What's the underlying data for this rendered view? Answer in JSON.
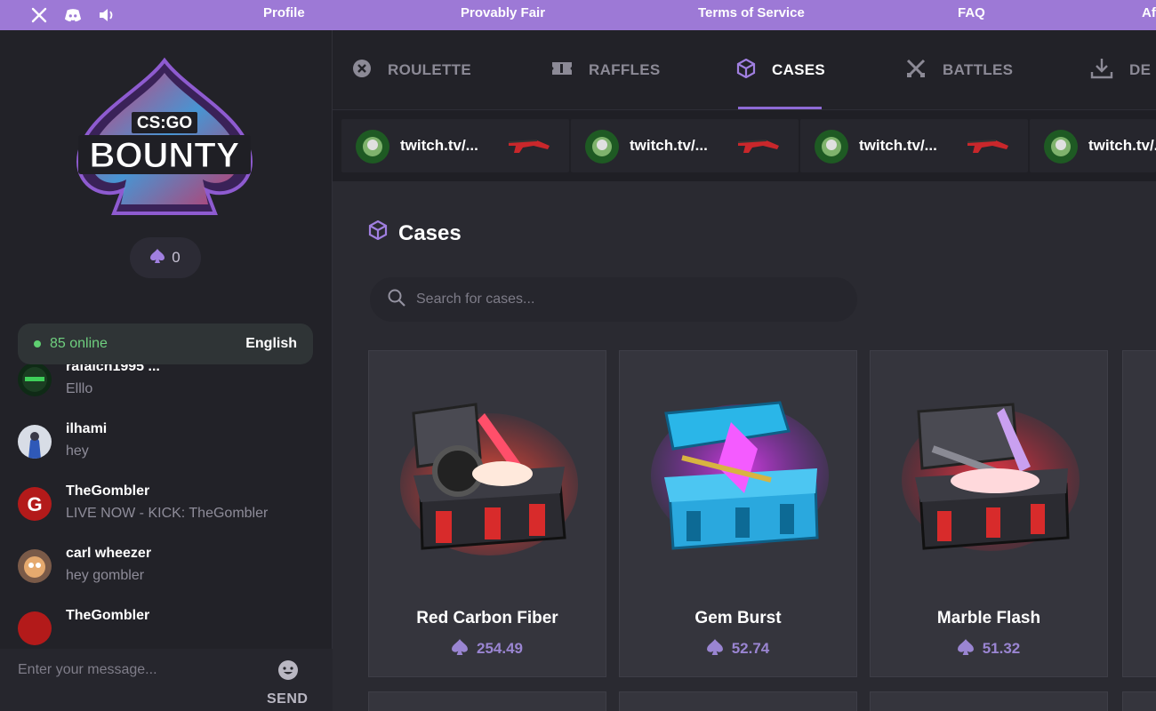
{
  "topbar": {
    "socials": [
      "x-icon",
      "discord-icon",
      "volume-icon"
    ],
    "links": [
      "Profile",
      "Provably Fair",
      "Terms of Service",
      "FAQ",
      "Af"
    ]
  },
  "sidebar": {
    "logo": {
      "line1": "CS:GO",
      "line2": "BOUNTY"
    },
    "balance": "0",
    "online": "85 online",
    "language": "English",
    "messages": [
      {
        "name": "rafalch1995 ...",
        "text": "Elllo"
      },
      {
        "name": "ilhami",
        "text": "hey"
      },
      {
        "name": "TheGombler",
        "text": "LIVE NOW - KICK: TheGombler"
      },
      {
        "name": "carl wheezer",
        "text": "hey gombler"
      },
      {
        "name": "TheGombler",
        "text": ""
      }
    ],
    "input_placeholder": "Enter your message...",
    "send_label": "SEND"
  },
  "tabs": [
    {
      "label": "ROULETTE",
      "icon": "roulette-icon"
    },
    {
      "label": "RAFFLES",
      "icon": "ticket-icon"
    },
    {
      "label": "CASES",
      "icon": "cube-icon",
      "active": true
    },
    {
      "label": "BATTLES",
      "icon": "swords-icon"
    },
    {
      "label": "DE",
      "icon": "download-icon"
    }
  ],
  "feed": [
    {
      "text": "twitch.tv/..."
    },
    {
      "text": "twitch.tv/..."
    },
    {
      "text": "twitch.tv/..."
    },
    {
      "text": "twitch.tv/..."
    }
  ],
  "main": {
    "title": "Cases",
    "search_placeholder": "Search for cases..."
  },
  "cases": [
    {
      "name": "Red Carbon Fiber",
      "price": "254.49"
    },
    {
      "name": "Gem Burst",
      "price": "52.74"
    },
    {
      "name": "Marble Flash",
      "price": "51.32"
    }
  ],
  "colors": {
    "accent": "#9d79d6",
    "online": "#5fd071",
    "price": "#9a85d2"
  }
}
